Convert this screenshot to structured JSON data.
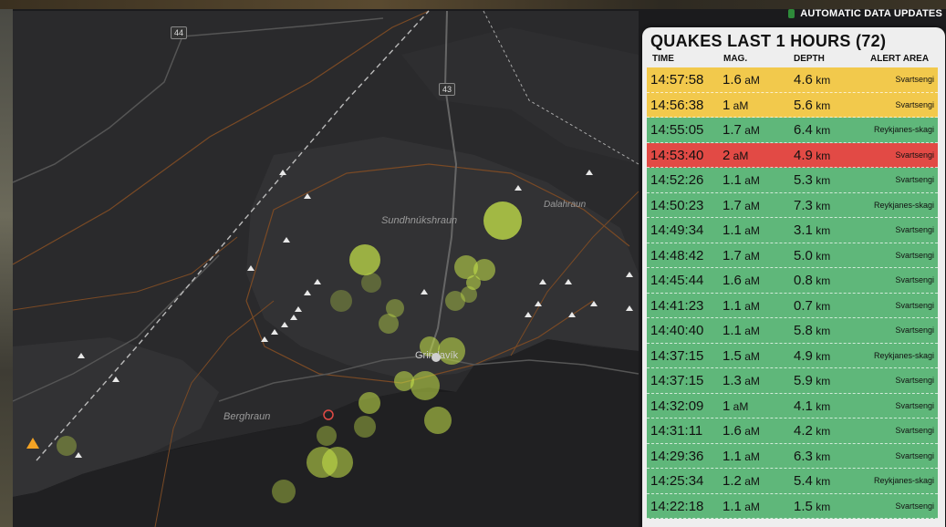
{
  "colors": {
    "yellow": "#f2c94c",
    "green": "#5fb77a",
    "red": "#e24a45",
    "quake": "#c8e64a"
  },
  "status": {
    "label": "AUTOMATIC DATA UPDATES"
  },
  "map": {
    "labels": {
      "sundhnuk": "Sundhnúkshraun",
      "grindavik": "Grindavík",
      "berghraun": "Berghraun",
      "dalahraun": "Dalahraun"
    },
    "roads": {
      "r44": "44",
      "r43": "43"
    }
  },
  "panel": {
    "title": "QUAKES LAST 1 HOURS (72)",
    "headers": {
      "time": "TIME",
      "mag": "MAG.",
      "depth": "DEPTH",
      "area": "ALERT AREA"
    },
    "rows": [
      {
        "time": "14:57:58",
        "mag": "1.6",
        "depth": "4.6",
        "area": "Svartsengi",
        "level": "yellow"
      },
      {
        "time": "14:56:38",
        "mag": "1",
        "depth": "5.6",
        "area": "Svartsengi",
        "level": "yellow"
      },
      {
        "time": "14:55:05",
        "mag": "1.7",
        "depth": "6.4",
        "area": "Reykjanes-skagi",
        "level": "green"
      },
      {
        "time": "14:53:40",
        "mag": "2",
        "depth": "4.9",
        "area": "Svartsengi",
        "level": "red"
      },
      {
        "time": "14:52:26",
        "mag": "1.1",
        "depth": "5.3",
        "area": "Svartsengi",
        "level": "green"
      },
      {
        "time": "14:50:23",
        "mag": "1.7",
        "depth": "7.3",
        "area": "Reykjanes-skagi",
        "level": "green"
      },
      {
        "time": "14:49:34",
        "mag": "1.1",
        "depth": "3.1",
        "area": "Svartsengi",
        "level": "green"
      },
      {
        "time": "14:48:42",
        "mag": "1.7",
        "depth": "5.0",
        "area": "Svartsengi",
        "level": "green"
      },
      {
        "time": "14:45:44",
        "mag": "1.6",
        "depth": "0.8",
        "area": "Svartsengi",
        "level": "green"
      },
      {
        "time": "14:41:23",
        "mag": "1.1",
        "depth": "0.7",
        "area": "Svartsengi",
        "level": "green"
      },
      {
        "time": "14:40:40",
        "mag": "1.1",
        "depth": "5.8",
        "area": "Svartsengi",
        "level": "green"
      },
      {
        "time": "14:37:15",
        "mag": "1.5",
        "depth": "4.9",
        "area": "Reykjanes-skagi",
        "level": "green"
      },
      {
        "time": "14:37:15",
        "mag": "1.3",
        "depth": "5.9",
        "area": "Svartsengi",
        "level": "green"
      },
      {
        "time": "14:32:09",
        "mag": "1",
        "depth": "4.1",
        "area": "Svartsengi",
        "level": "green"
      },
      {
        "time": "14:31:11",
        "mag": "1.6",
        "depth": "4.2",
        "area": "Svartsengi",
        "level": "green"
      },
      {
        "time": "14:29:36",
        "mag": "1.1",
        "depth": "6.3",
        "area": "Svartsengi",
        "level": "green"
      },
      {
        "time": "14:25:34",
        "mag": "1.2",
        "depth": "5.4",
        "area": "Reykjanes-skagi",
        "level": "green"
      },
      {
        "time": "14:22:18",
        "mag": "1.1",
        "depth": "1.5",
        "area": "Svartsengi",
        "level": "green"
      }
    ]
  }
}
